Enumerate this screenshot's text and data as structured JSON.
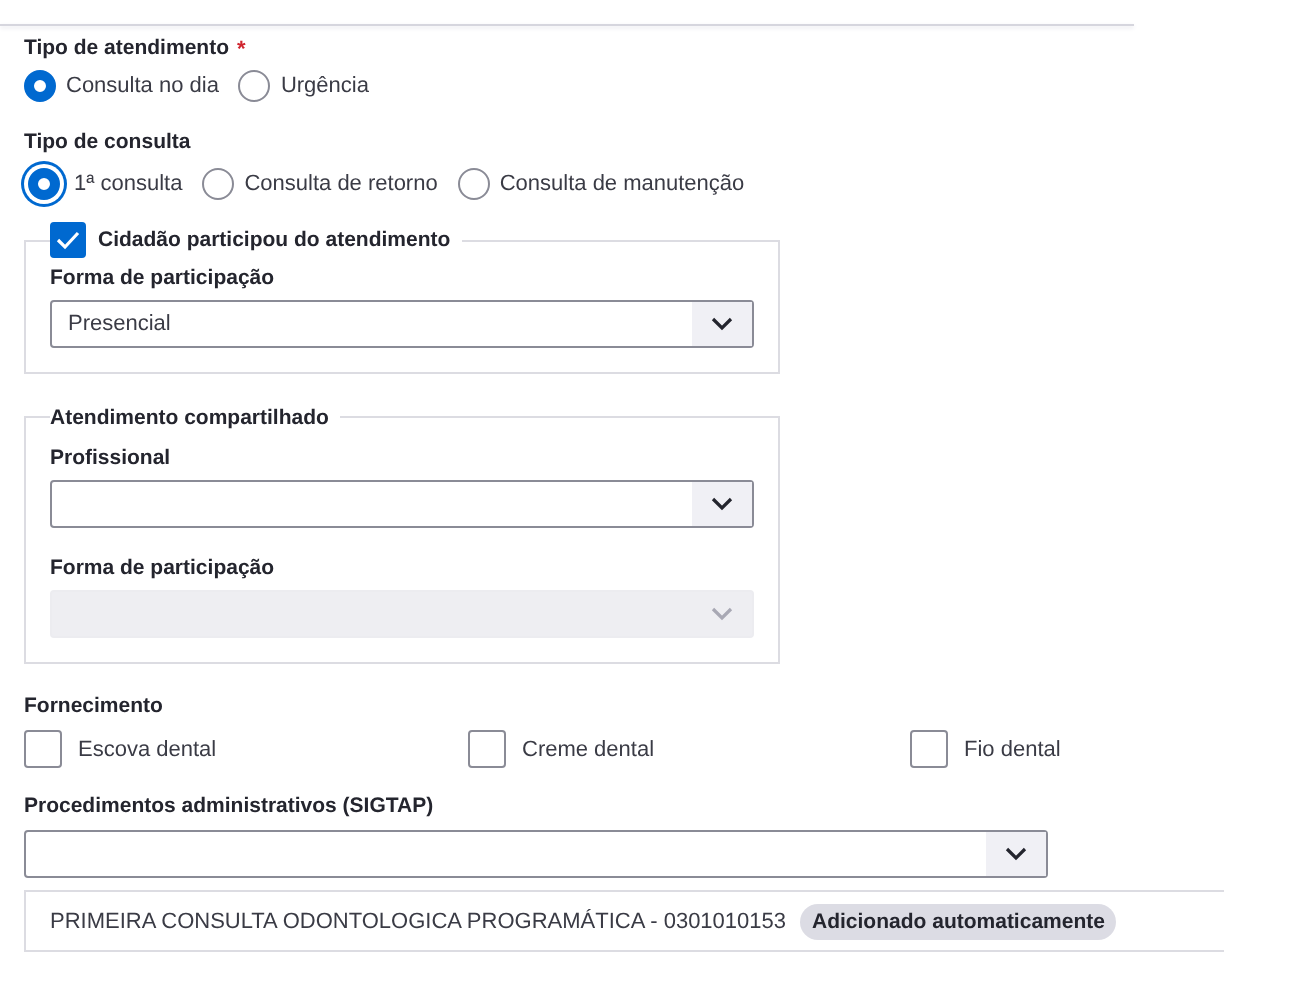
{
  "tipo_atendimento": {
    "label": "Tipo de atendimento",
    "required_mark": "*",
    "options": [
      {
        "label": "Consulta no dia",
        "selected": true
      },
      {
        "label": "Urgência",
        "selected": false
      }
    ]
  },
  "tipo_consulta": {
    "label": "Tipo de consulta",
    "options": [
      {
        "label": "1ª consulta",
        "selected": true
      },
      {
        "label": "Consulta de retorno",
        "selected": false
      },
      {
        "label": "Consulta de manutenção",
        "selected": false
      }
    ]
  },
  "fieldsets": [
    {
      "kind": "checkbox",
      "legend": "Cidadão participou do atendimento",
      "checked": true,
      "fields": [
        {
          "label": "Forma de participação",
          "value": "Presencial",
          "disabled": false
        }
      ]
    },
    {
      "kind": "plain",
      "legend": "Atendimento compartilhado",
      "fields": [
        {
          "label": "Profissional",
          "disabled": false
        },
        {
          "label": "Forma de participação",
          "disabled": true
        }
      ]
    }
  ],
  "fornecimento": {
    "label": "Fornecimento",
    "items": [
      {
        "label": "Escova dental",
        "checked": false
      },
      {
        "label": "Creme dental",
        "checked": false
      },
      {
        "label": "Fio dental",
        "checked": false
      }
    ]
  },
  "procedimentos": {
    "label": "Procedimentos administrativos (SIGTAP)",
    "items": [
      {
        "text": "PRIMEIRA CONSULTA ODONTOLOGICA PROGRAMÁTICA - 0301010153",
        "badge": "Adicionado automaticamente"
      }
    ]
  }
}
